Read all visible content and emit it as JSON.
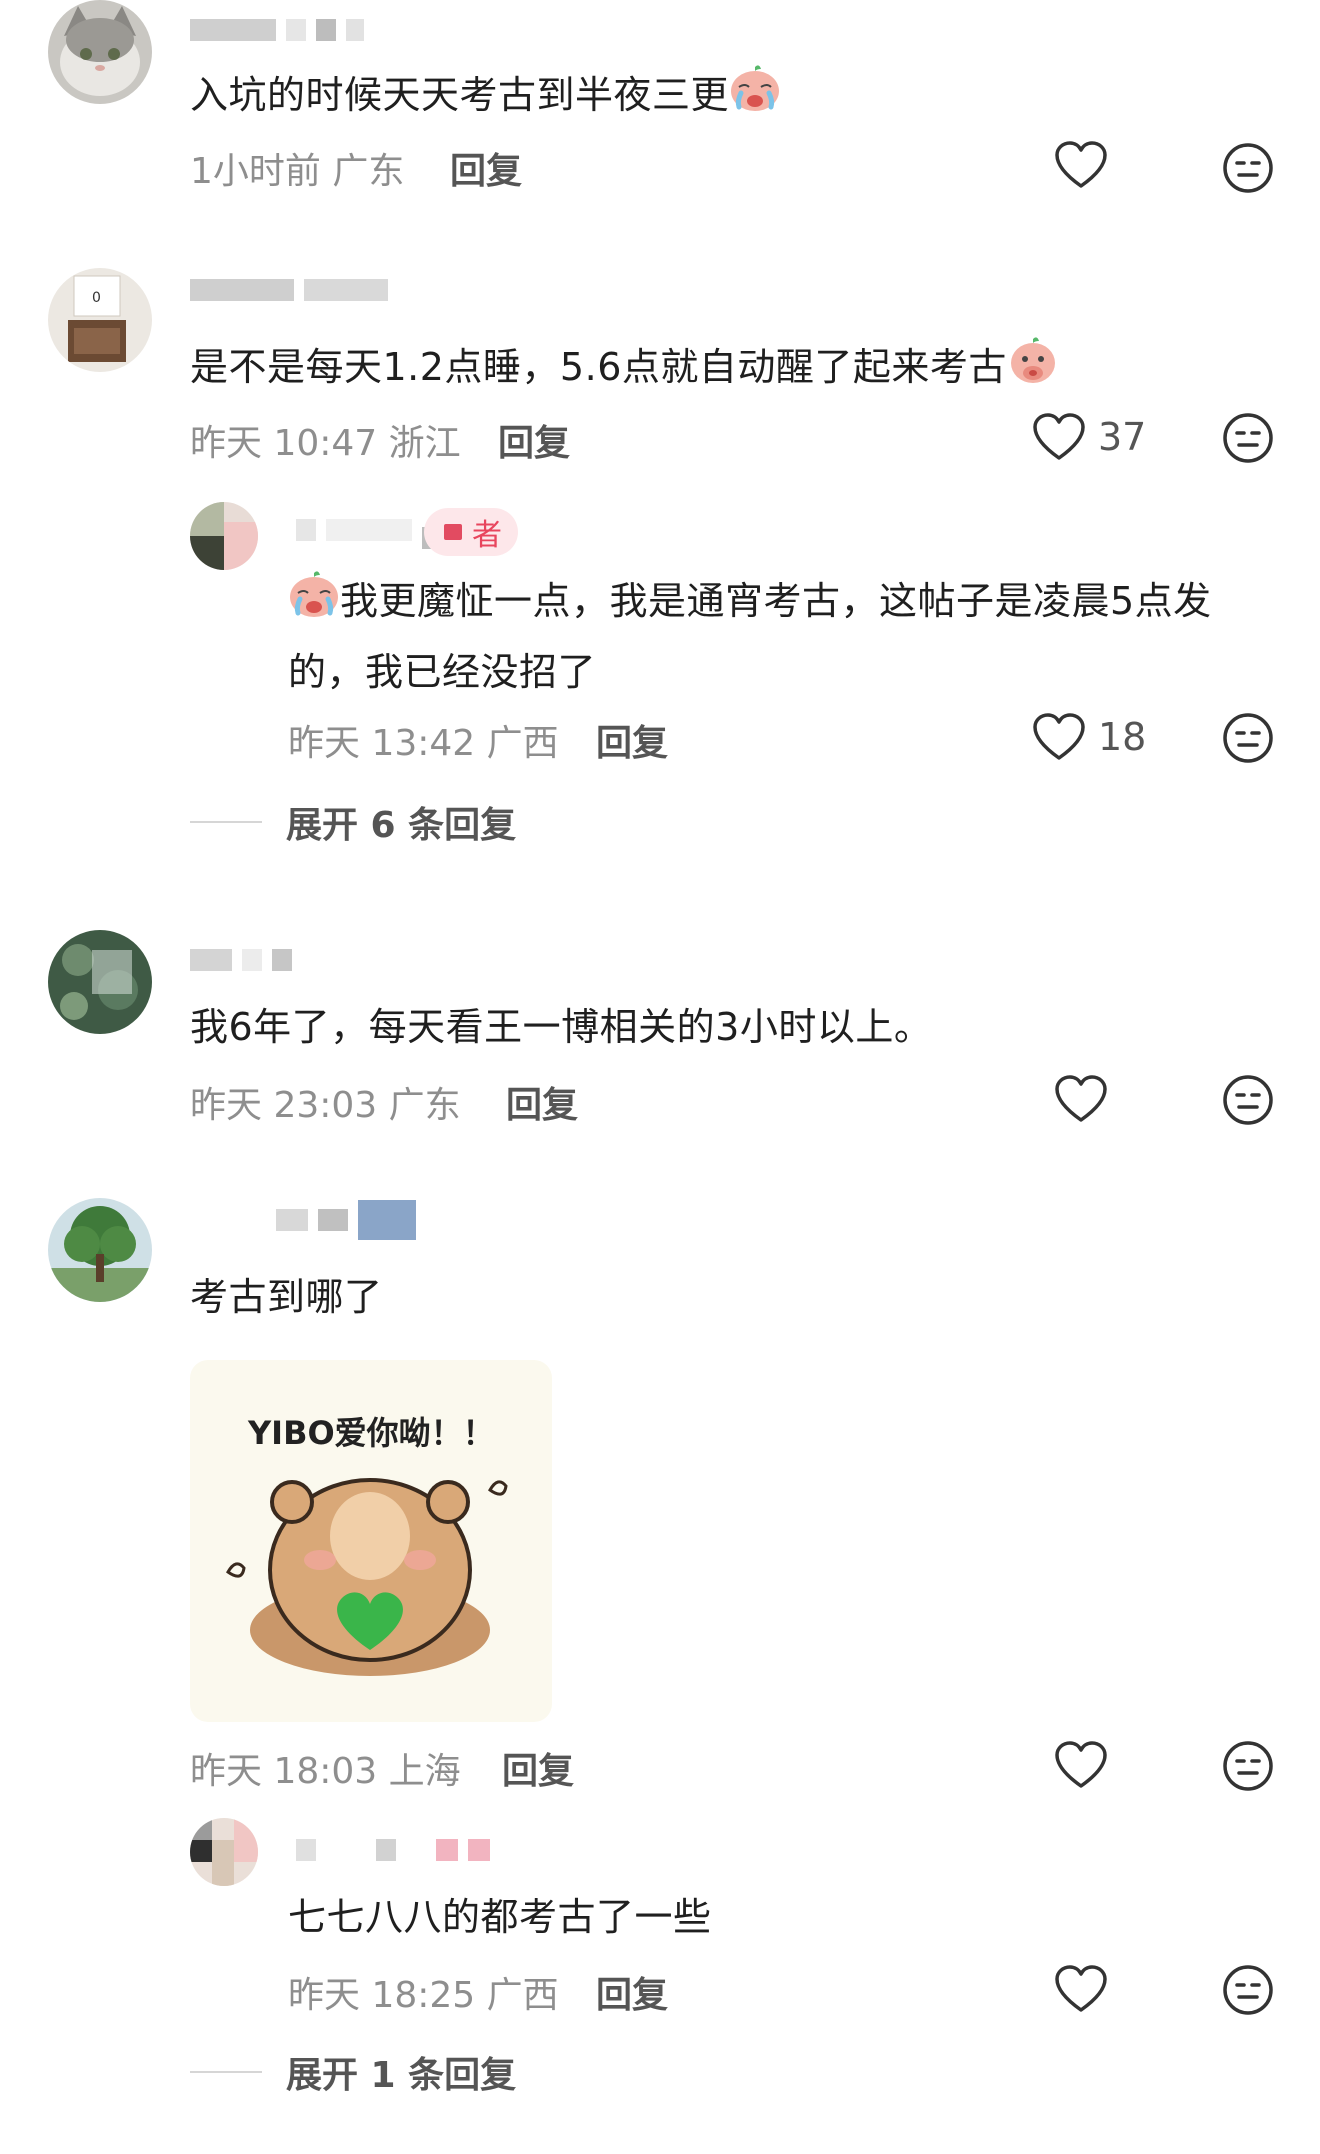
{
  "comments": [
    {
      "text": "入坑的时候天天考古到半夜三更",
      "time": "1小时前",
      "location": "广东",
      "reply_label": "回复",
      "likes": ""
    },
    {
      "text": "是不是每天1.2点睡，5.6点就自动醒了起来考古",
      "time": "昨天 10:47",
      "location": "浙江",
      "reply_label": "回复",
      "likes": "37",
      "reply": {
        "badge": "者",
        "text": "我更魔怔一点，我是通宵考古，这帖子是凌晨5点发的，我已经没招了",
        "time": "昨天 13:42",
        "location": "广西",
        "reply_label": "回复",
        "likes": "18"
      },
      "expand": "展开 6 条回复"
    },
    {
      "text": "我6年了，每天看王一博相关的3小时以上。",
      "time": "昨天 23:03",
      "location": "广东",
      "reply_label": "回复",
      "likes": ""
    },
    {
      "text": "考古到哪了",
      "sticker_caption": "YIBO爱你呦！！",
      "time": "昨天 18:03",
      "location": "上海",
      "reply_label": "回复",
      "likes": "",
      "reply": {
        "text": "七七八八的都考古了一些",
        "time": "昨天 18:25",
        "location": "广西",
        "reply_label": "回复",
        "likes": ""
      },
      "expand": "展开 1 条回复"
    }
  ],
  "colors": {
    "meta_text": "#8e8e8e",
    "badge_bg": "#fde7ea",
    "badge_text": "#e8455d",
    "heart_green": "#3ab54a"
  },
  "icons": [
    "heart-outline-icon",
    "meh-face-icon",
    "crying-emoji",
    "thinking-emoji"
  ]
}
